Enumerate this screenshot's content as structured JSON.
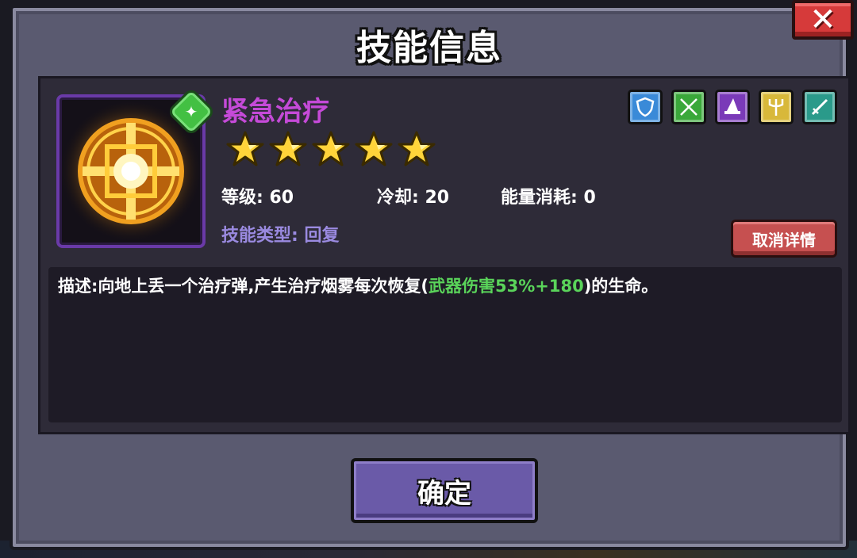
{
  "dialog": {
    "title": "技能信息",
    "close_label": "✕"
  },
  "skill": {
    "name": "紧急治疗",
    "name_color": "#c54ad8",
    "icon": "holy-rune-icon",
    "tier_badge_icon": "green-tier-badge-icon",
    "stars": 5,
    "level_label": "等级:",
    "level_value": "60",
    "cooldown_label": "冷却:",
    "cooldown_value": "20",
    "energy_label": "能量消耗:",
    "energy_value": "0",
    "type_label": "技能类型:",
    "type_value": "回复"
  },
  "weapon_types": [
    {
      "icon": "shield-icon",
      "color": "#3a8ad8"
    },
    {
      "icon": "crossed-swords-icon",
      "color": "#3aa83a"
    },
    {
      "icon": "wizard-hat-icon",
      "color": "#7a3ab8"
    },
    {
      "icon": "trident-icon",
      "color": "#d8b83a"
    },
    {
      "icon": "sword-icon",
      "color": "#2a9a8a"
    }
  ],
  "buttons": {
    "cancel_details": "取消详情",
    "confirm": "确定"
  },
  "description": {
    "prefix": "描述:向地上丢一个治疗弹,产生治疗烟雾每次恢复(",
    "highlight": "武器伤害53%+180",
    "suffix": ")的生命。",
    "highlight_color": "#5ad45a"
  }
}
